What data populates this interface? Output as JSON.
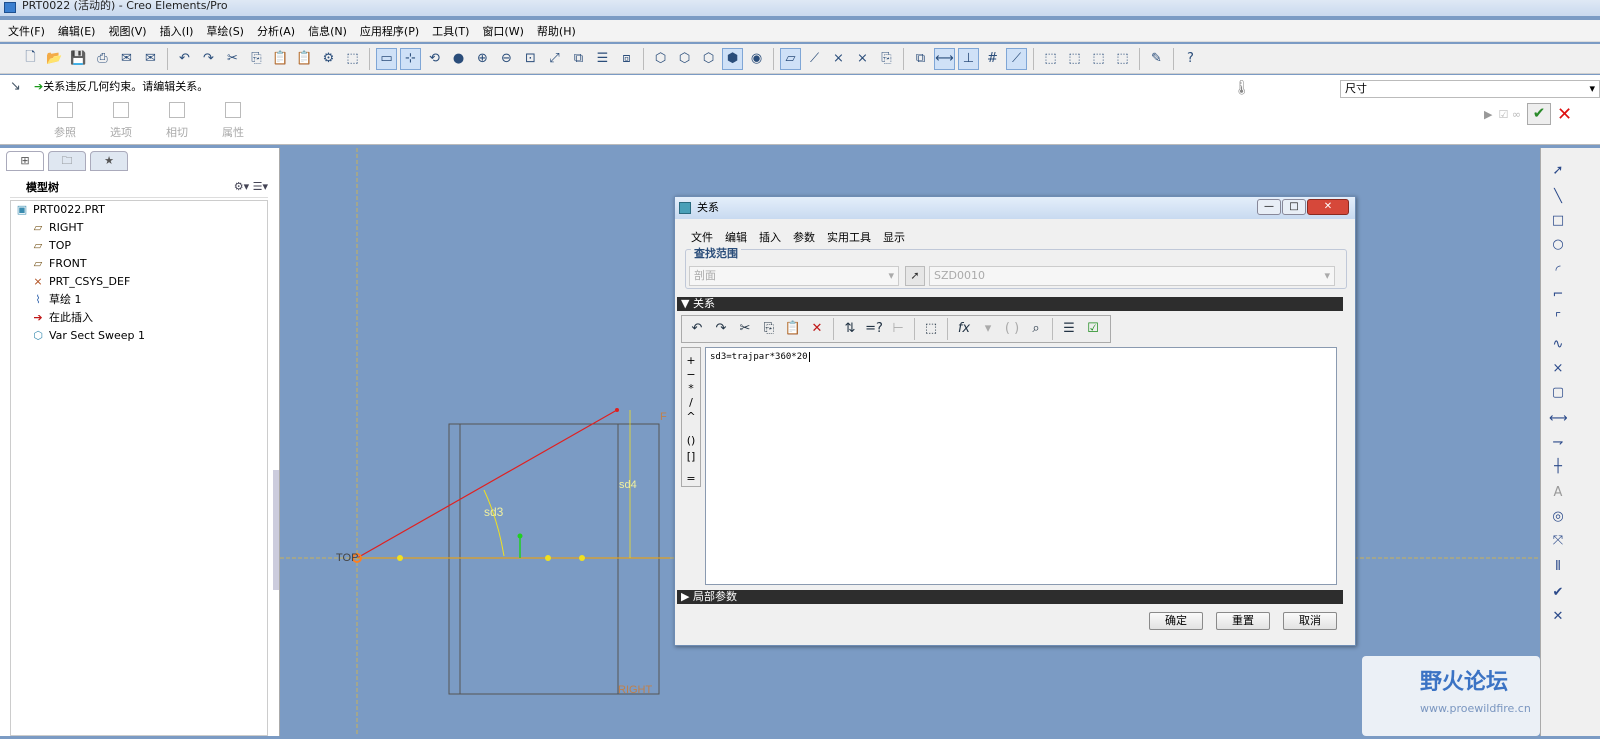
{
  "window": {
    "title": "PRT0022 (活动的) - Creo Elements/Pro"
  },
  "menu": [
    "文件(F)",
    "编辑(E)",
    "视图(V)",
    "插入(I)",
    "草绘(S)",
    "分析(A)",
    "信息(N)",
    "应用程序(P)",
    "工具(T)",
    "窗口(W)",
    "帮助(H)"
  ],
  "message": {
    "text": "关系违反几何约束。请编辑关系。"
  },
  "dashboard": {
    "tabs": [
      "参照",
      "选项",
      "相切",
      "属性"
    ],
    "dim_select": "尺寸"
  },
  "model_tree": {
    "title": "模型树",
    "items": [
      {
        "label": "PRT0022.PRT",
        "icon": "part-icon"
      },
      {
        "label": "RIGHT",
        "icon": "datum-plane-icon"
      },
      {
        "label": "TOP",
        "icon": "datum-plane-icon"
      },
      {
        "label": "FRONT",
        "icon": "datum-plane-icon"
      },
      {
        "label": "PRT_CSYS_DEF",
        "icon": "csys-icon"
      },
      {
        "label": "草绘 1",
        "icon": "sketch-icon"
      },
      {
        "label": "在此插入",
        "icon": "insert-arrow-icon"
      },
      {
        "label": "Var Sect Sweep 1",
        "icon": "sweep-icon"
      }
    ]
  },
  "sketch": {
    "label_top": "TOP",
    "label_right": "RIGHT",
    "label_f": "F",
    "dim_sd3": "sd3",
    "dim_sd4": "sd4"
  },
  "dialog": {
    "title": "关系",
    "menu": [
      "文件",
      "编辑",
      "插入",
      "参数",
      "实用工具",
      "显示"
    ],
    "find_label": "查找范围",
    "scope_value": "剖面",
    "item_value": "SZD0010",
    "relations_header": "关系",
    "relation_text": "sd3=trajpar*360*20",
    "local_params_header": "局部参数",
    "operators": [
      "+",
      "−",
      "*",
      "/",
      "^",
      "()",
      "[]",
      "="
    ],
    "buttons": {
      "ok": "确定",
      "reset": "重置",
      "cancel": "取消"
    }
  },
  "watermark": {
    "text": "野火论坛",
    "url": "www.proewildfire.cn"
  },
  "colors": {
    "canvas": "#7b9bc4",
    "sketch_line": "#e02020",
    "accent": "#3b73c4"
  }
}
